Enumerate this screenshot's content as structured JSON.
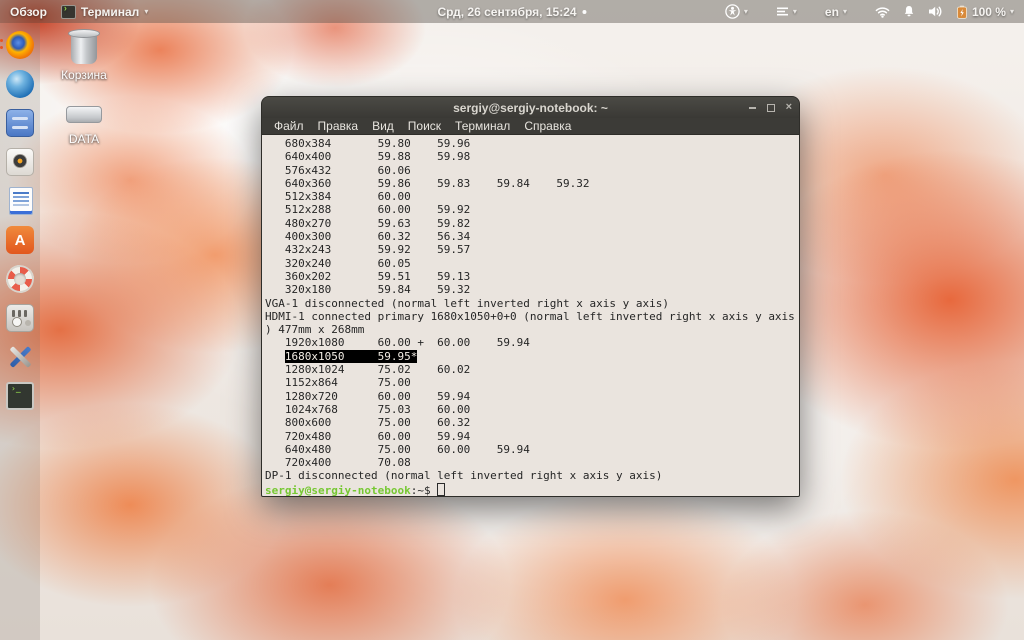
{
  "top_bar": {
    "activities_label": "Обзор",
    "app_menu_label": "Терминал",
    "clock": "Срд, 26 сентября, 15:24",
    "keyboard_layout": "en",
    "battery_percent": "100 %"
  },
  "desktop_icons": [
    {
      "name": "trash",
      "icon": "trash-icon",
      "label": "Корзина"
    },
    {
      "name": "data-drive",
      "icon": "drive-icon",
      "label": "DATA"
    }
  ],
  "dock_items": [
    {
      "name": "firefox",
      "icon": "firefox-icon",
      "running": true
    },
    {
      "name": "thunderbird",
      "icon": "thunderbird-icon"
    },
    {
      "name": "files",
      "icon": "files-icon"
    },
    {
      "name": "rhythmbox",
      "icon": "rhythmbox-icon"
    },
    {
      "name": "libreoffice-writer",
      "icon": "writer-icon"
    },
    {
      "name": "ubuntu-software",
      "icon": "software-center-icon"
    },
    {
      "name": "help",
      "icon": "help-icon"
    },
    {
      "name": "tweaks",
      "icon": "tweaks-icon"
    },
    {
      "name": "tools",
      "icon": "tools-icon"
    },
    {
      "name": "terminal",
      "icon": "terminal-icon"
    }
  ],
  "terminal": {
    "title": "sergiy@sergiy-notebook: ~",
    "menu": [
      "Файл",
      "Правка",
      "Вид",
      "Поиск",
      "Терминал",
      "Справка"
    ],
    "lines": [
      [
        {
          "t": "   680x384       59.80    59.96"
        }
      ],
      [
        {
          "t": "   640x400       59.88    59.98"
        }
      ],
      [
        {
          "t": "   576x432       60.06"
        }
      ],
      [
        {
          "t": "   640x360       59.86    59.83    59.84    59.32"
        }
      ],
      [
        {
          "t": "   512x384       60.00"
        }
      ],
      [
        {
          "t": "   512x288       60.00    59.92"
        }
      ],
      [
        {
          "t": "   480x270       59.63    59.82"
        }
      ],
      [
        {
          "t": "   400x300       60.32    56.34"
        }
      ],
      [
        {
          "t": "   432x243       59.92    59.57"
        }
      ],
      [
        {
          "t": "   320x240       60.05"
        }
      ],
      [
        {
          "t": "   360x202       59.51    59.13"
        }
      ],
      [
        {
          "t": "   320x180       59.84    59.32"
        }
      ],
      [
        {
          "t": "VGA-1 disconnected (normal left inverted right x axis y axis)"
        }
      ],
      [
        {
          "t": "HDMI-1 connected primary 1680x1050+0+0 (normal left inverted right x axis y axis"
        }
      ],
      [
        {
          "t": ") 477mm x 268mm"
        }
      ],
      [
        {
          "t": "   1920x1080     60.00 +  60.00    59.94"
        }
      ],
      [
        {
          "t": "   "
        },
        {
          "t": "1680x1050     59.95*",
          "c": "sel"
        }
      ],
      [
        {
          "t": "   1280x1024     75.02    60.02"
        }
      ],
      [
        {
          "t": "   1152x864      75.00"
        }
      ],
      [
        {
          "t": "   1280x720      60.00    59.94"
        }
      ],
      [
        {
          "t": "   1024x768      75.03    60.00"
        }
      ],
      [
        {
          "t": "   800x600       75.00    60.32"
        }
      ],
      [
        {
          "t": "   720x480       60.00    59.94"
        }
      ],
      [
        {
          "t": "   640x480       75.00    60.00    59.94"
        }
      ],
      [
        {
          "t": "   720x400       70.08"
        }
      ],
      [
        {
          "t": "DP-1 disconnected (normal left inverted right x axis y axis)"
        }
      ],
      [
        {
          "t": "sergiy@sergiy-notebook",
          "c": "green"
        },
        {
          "t": ":~$ "
        },
        {
          "t": "",
          "c": "cursor"
        }
      ]
    ]
  },
  "colors": {
    "prompt_green": "#76c832",
    "selection_bg": "#000000",
    "titlebar": "#3c3b37",
    "leaf_orange": "#e2601e",
    "dock_indicator": "#e95420"
  }
}
